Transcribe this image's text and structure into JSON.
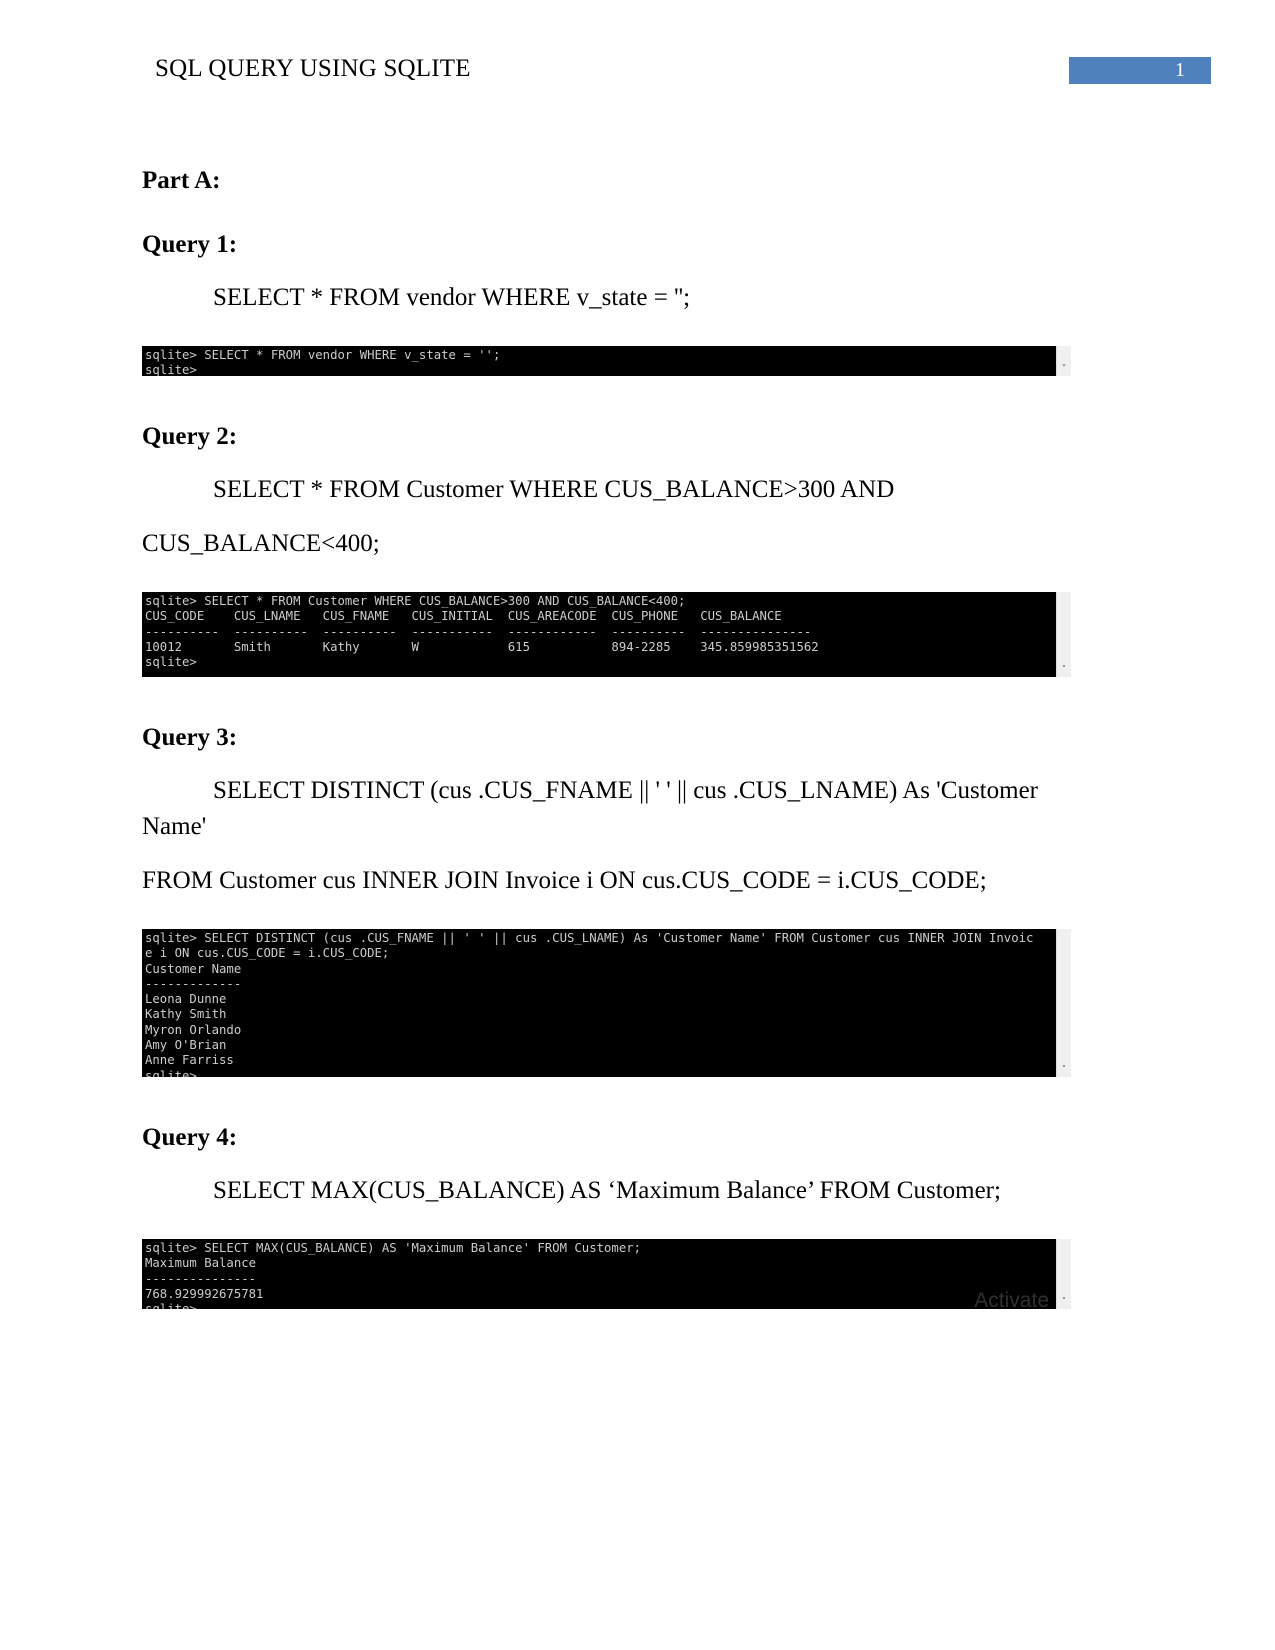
{
  "header": {
    "title": "SQL QUERY USING SQLITE",
    "page_number": "1",
    "badge_color": "#4f81bd"
  },
  "document": {
    "part_heading": "Part A:"
  },
  "queries": [
    {
      "heading": "Query 1:",
      "sql_lines": [
        "SELECT * FROM vendor WHERE v_state = '';"
      ],
      "terminal": {
        "lines": [
          "sqlite> SELECT * FROM vendor WHERE v_state = '';",
          "sqlite>"
        ]
      }
    },
    {
      "heading": "Query 2:",
      "sql_lines": [
        "SELECT   *   FROM   Customer   WHERE   CUS_BALANCE>300   AND",
        "CUS_BALANCE<400;"
      ],
      "terminal": {
        "lines": [
          "sqlite> SELECT * FROM Customer WHERE CUS_BALANCE>300 AND CUS_BALANCE<400;",
          "CUS_CODE    CUS_LNAME   CUS_FNAME   CUS_INITIAL  CUS_AREACODE  CUS_PHONE   CUS_BALANCE",
          "----------  ----------  ----------  -----------  ------------  ----------  ---------------",
          "10012       Smith       Kathy       W            615           894-2285    345.859985351562",
          "sqlite>"
        ]
      }
    },
    {
      "heading": "Query 3:",
      "sql_lines": [
        "SELECT DISTINCT (cus .CUS_FNAME || ' ' || cus .CUS_LNAME) As 'Customer Name'",
        "FROM Customer cus INNER JOIN Invoice i ON cus.CUS_CODE = i.CUS_CODE;"
      ],
      "terminal": {
        "lines": [
          "sqlite> SELECT DISTINCT (cus .CUS_FNAME || ' ' || cus .CUS_LNAME) As 'Customer Name' FROM Customer cus INNER JOIN Invoic",
          "e i ON cus.CUS_CODE = i.CUS_CODE;",
          "Customer Name",
          "-------------",
          "Leona Dunne",
          "Kathy Smith",
          "Myron Orlando",
          "Amy O'Brian",
          "Anne Farriss",
          "sqlite>"
        ]
      }
    },
    {
      "heading": "Query 4:",
      "sql_lines": [
        "SELECT MAX(CUS_BALANCE) AS ‘Maximum Balance’ FROM Customer;"
      ],
      "terminal": {
        "lines": [
          "sqlite> SELECT MAX(CUS_BALANCE) AS 'Maximum Balance' FROM Customer;",
          "Maximum Balance",
          "---------------",
          "768.929992675781",
          "sqlite>"
        ],
        "watermark": "Activate"
      }
    }
  ],
  "icons": {
    "scroll_down_arrow": "ˇ"
  }
}
